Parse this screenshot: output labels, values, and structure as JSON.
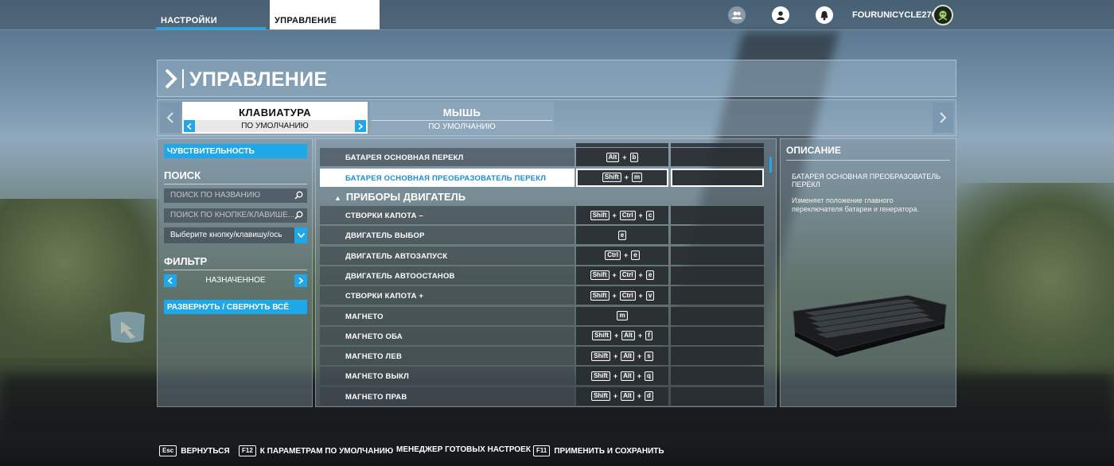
{
  "topnav": {
    "tabs": [
      {
        "label": "НАСТРОЙКИ"
      },
      {
        "label": "УПРАВЛЕНИЕ"
      }
    ],
    "username": "FOURUNICYCLE270"
  },
  "page": {
    "title": "УПРАВЛЕНИЕ"
  },
  "devices": {
    "keyboard": {
      "label": "КЛАВИАТУРА",
      "preset": "ПО УМОЛЧАНИЮ"
    },
    "mouse": {
      "label": "МЫШЬ",
      "preset": "ПО УМОЛЧАНИЮ"
    }
  },
  "sidebar": {
    "sensitivity_button": "ЧУВСТВИТЕЛЬНОСТЬ",
    "search_heading": "ПОИСК",
    "search_by_name_placeholder": "ПОИСК ПО НАЗВАНИЮ",
    "search_by_key_placeholder": "ПОИСК ПО КНОПКЕ/КЛАВИШЕ...",
    "select_key_axis": "Выберите кнопку/клавишу/ось",
    "filter_heading": "ФИЛЬТР",
    "filter_value": "НАЗНАЧЕННОЕ",
    "expand_collapse_button": "РАЗВЕРНУТЬ / СВЕРНУТЬ ВСЁ"
  },
  "bindings": {
    "rows_before_category": [
      {
        "name": "БАТАРЕЯ ОСНОВНАЯ ПЕРЕКЛ",
        "keys": [
          "Alt",
          "b"
        ]
      },
      {
        "name": "БАТАРЕЯ ОСНОВНАЯ ПРЕОБРАЗОВАТЕЛЬ ПЕРЕКЛ",
        "keys": [
          "Shift",
          "m"
        ],
        "selected": true
      }
    ],
    "category": "ПРИБОРЫ ДВИГАТЕЛЬ",
    "rows": [
      {
        "name": "СТВОРКИ КАПОТА –",
        "keys": [
          "Shift",
          "Ctrl",
          "c"
        ]
      },
      {
        "name": "ДВИГАТЕЛЬ ВЫБОР",
        "keys": [
          "e"
        ]
      },
      {
        "name": "ДВИГАТЕЛЬ АВТОЗАПУСК",
        "keys": [
          "Ctrl",
          "e"
        ]
      },
      {
        "name": "ДВИГАТЕЛЬ АВТООСТАНОВ",
        "keys": [
          "Shift",
          "Ctrl",
          "e"
        ]
      },
      {
        "name": "СТВОРКИ КАПОТА +",
        "keys": [
          "Shift",
          "Ctrl",
          "v"
        ]
      },
      {
        "name": "МАГНЕТО",
        "keys": [
          "m"
        ]
      },
      {
        "name": "МАГНЕТО ОБА",
        "keys": [
          "Shift",
          "Alt",
          "f"
        ]
      },
      {
        "name": "МАГНЕТО ЛЕВ",
        "keys": [
          "Shift",
          "Alt",
          "s"
        ]
      },
      {
        "name": "МАГНЕТО ВЫКЛ",
        "keys": [
          "Shift",
          "Alt",
          "q"
        ]
      },
      {
        "name": "МАГНЕТО ПРАВ",
        "keys": [
          "Shift",
          "Alt",
          "d"
        ]
      }
    ]
  },
  "description": {
    "heading": "ОПИСАНИЕ",
    "name": "БАТАРЕЯ ОСНОВНАЯ ПРЕОБРАЗОВАТЕЛЬ ПЕРЕКЛ",
    "text": "Изменяет положение главного переключателя батареи и генератора."
  },
  "bottombar": {
    "back": {
      "key": "Esc",
      "label": "ВЕРНУТЬСЯ"
    },
    "defaults": {
      "key": "F12",
      "label": "К ПАРАМЕТРАМ ПО УМОЛЧАНИЮ"
    },
    "presets": {
      "label": "МЕНЕДЖЕР ГОТОВЫХ НАСТРОЕК"
    },
    "apply": {
      "key": "F11",
      "label": "ПРИМЕНИТЬ И СОХРАНИТЬ"
    }
  },
  "colors": {
    "accent": "#1fa8e8",
    "selected_text": "#1a8fd0"
  }
}
